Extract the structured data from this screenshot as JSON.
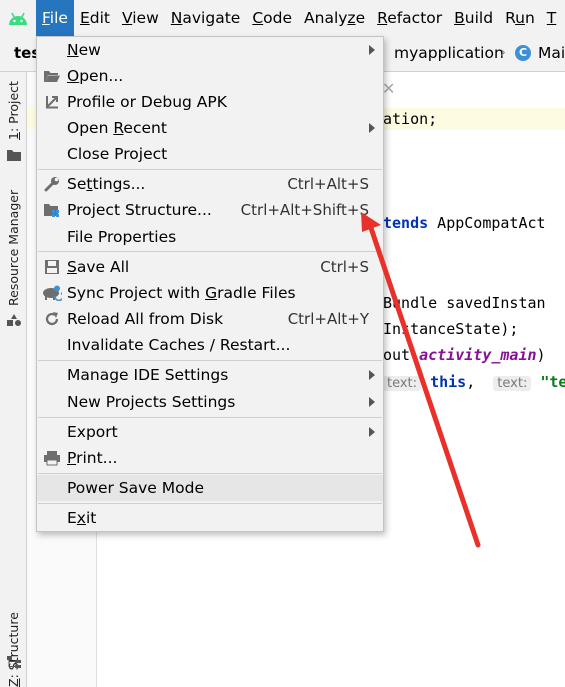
{
  "menubar": {
    "items": [
      {
        "pre": "",
        "ul": "F",
        "post": "ile"
      },
      {
        "pre": "",
        "ul": "E",
        "post": "dit"
      },
      {
        "pre": "",
        "ul": "V",
        "post": "iew"
      },
      {
        "pre": "",
        "ul": "N",
        "post": "avigate"
      },
      {
        "pre": "",
        "ul": "C",
        "post": "ode"
      },
      {
        "pre": "Analy",
        "ul": "z",
        "post": "e"
      },
      {
        "pre": "",
        "ul": "R",
        "post": "efactor"
      },
      {
        "pre": "",
        "ul": "B",
        "post": "uild"
      },
      {
        "pre": "R",
        "ul": "u",
        "post": "n"
      },
      {
        "pre": "",
        "ul": "T",
        "post": ""
      }
    ]
  },
  "navbar": {
    "project": "tes",
    "crumb_package": "myapplication",
    "class_icon_letter": "C",
    "crumb_class": "Mai"
  },
  "leftstrip": {
    "project_num": "1",
    "project_label": ": Project",
    "resource_manager": "Resource Manager",
    "structure_num": "Z",
    "structure_label": ": Structure"
  },
  "editor": {
    "line1": "ation;",
    "line2_kw": "tends",
    "line2_rest": " AppCompatAct",
    "line3": "Bundle savedInstan",
    "line4": "InstanceState);",
    "line5_pre": "out.",
    "line5_it": "activity_main",
    "line5_post": ")",
    "line6_hint1": "text:",
    "line6_kw": "this",
    "line6_sep": ",",
    "line6_hint2": "text:",
    "line6_str": "\"tes"
  },
  "file_menu": {
    "items": [
      {
        "pre": "",
        "ul": "N",
        "post": "ew",
        "shortcut": "",
        "submenu": true
      },
      {
        "pre": "",
        "ul": "O",
        "post": "pen...",
        "shortcut": "",
        "submenu": false
      },
      {
        "pre": "Profile or Debug APK",
        "ul": "",
        "post": "",
        "shortcut": "",
        "submenu": false
      },
      {
        "pre": "Open ",
        "ul": "R",
        "post": "ecent",
        "shortcut": "",
        "submenu": true
      },
      {
        "pre": "Close Pro",
        "ul": "j",
        "post": "ect",
        "shortcut": "",
        "submenu": false
      },
      {
        "pre": "Se",
        "ul": "t",
        "post": "tings...",
        "shortcut": "Ctrl+Alt+S",
        "submenu": false
      },
      {
        "pre": "Project Structure...",
        "ul": "",
        "post": "",
        "shortcut": "Ctrl+Alt+Shift+S",
        "submenu": false
      },
      {
        "pre": "File Properties",
        "ul": "",
        "post": "",
        "shortcut": "",
        "submenu": false
      },
      {
        "pre": "",
        "ul": "S",
        "post": "ave All",
        "shortcut": "Ctrl+S",
        "submenu": false
      },
      {
        "pre": "Sync Project with ",
        "ul": "G",
        "post": "radle Files",
        "shortcut": "",
        "submenu": false
      },
      {
        "pre": "Reload All from Disk",
        "ul": "",
        "post": "",
        "shortcut": "Ctrl+Alt+Y",
        "submenu": false
      },
      {
        "pre": "Invalidate Caches / Restart...",
        "ul": "",
        "post": "",
        "shortcut": "",
        "submenu": false
      },
      {
        "pre": "Manage IDE Settings",
        "ul": "",
        "post": "",
        "shortcut": "",
        "submenu": true
      },
      {
        "pre": "New Projects Settings",
        "ul": "",
        "post": "",
        "shortcut": "",
        "submenu": true
      },
      {
        "pre": "Export",
        "ul": "",
        "post": "",
        "shortcut": "",
        "submenu": true
      },
      {
        "pre": "",
        "ul": "P",
        "post": "rint...",
        "shortcut": "",
        "submenu": false
      },
      {
        "pre": "Power Save Mode",
        "ul": "",
        "post": "",
        "shortcut": "",
        "submenu": false
      },
      {
        "pre": "E",
        "ul": "x",
        "post": "it",
        "shortcut": "",
        "submenu": false
      }
    ]
  },
  "colors": {
    "menu_active": "#2675bf",
    "annotation_arrow": "#e8312a",
    "android_green": "#3ddc84"
  }
}
